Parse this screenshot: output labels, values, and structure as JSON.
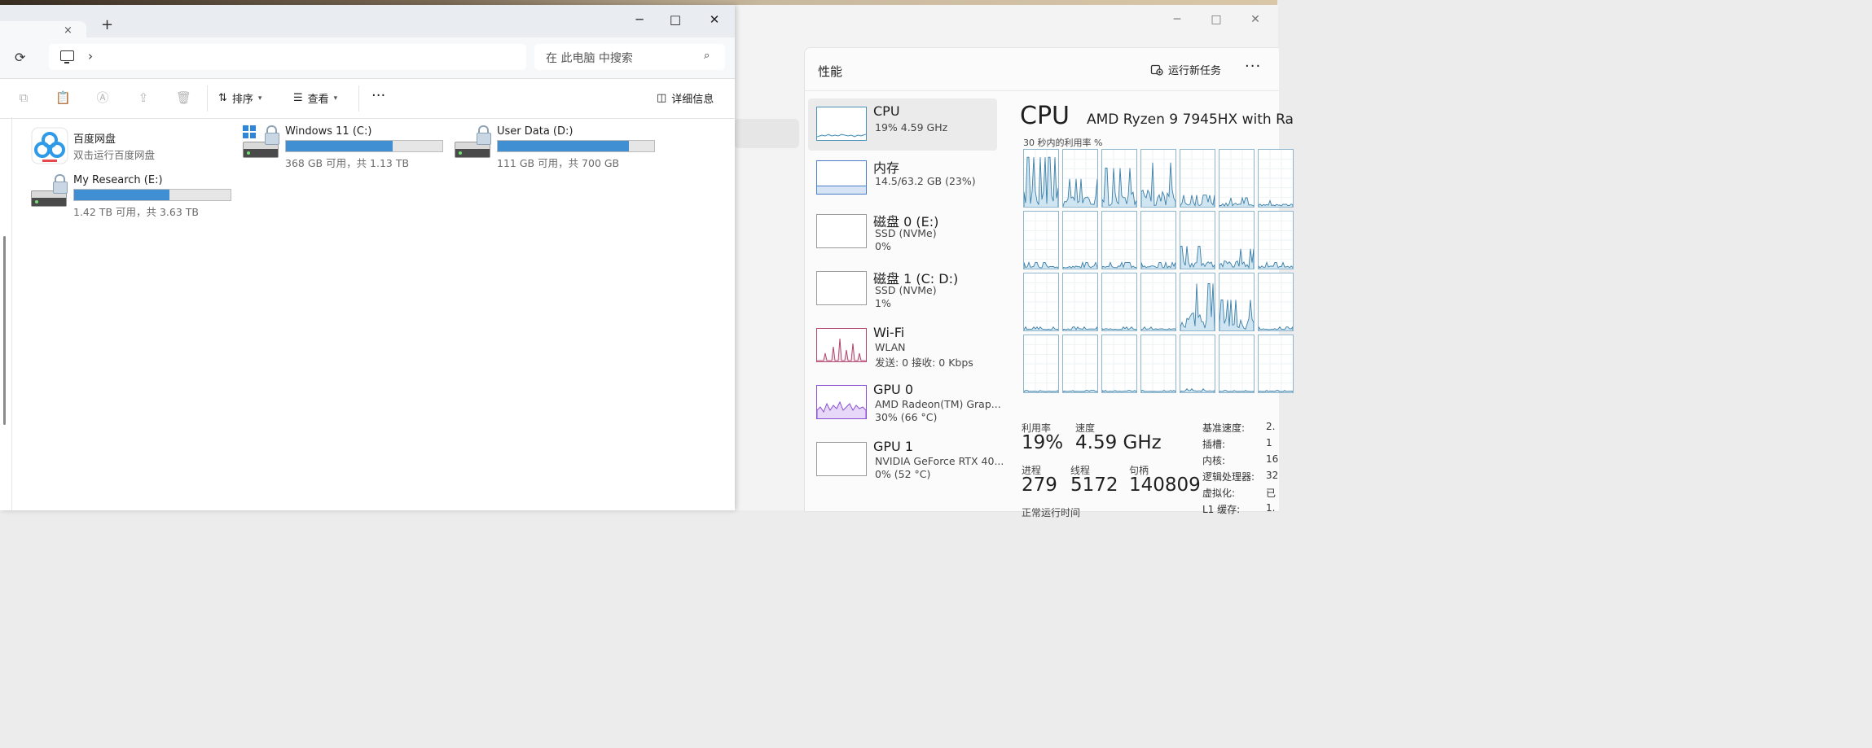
{
  "explorer": {
    "tab_close": "×",
    "new_tab": "+",
    "window_controls": {
      "minimize": "─",
      "maximize": "□",
      "close": "✕"
    },
    "refresh_icon": "⟳",
    "breadcrumb_separator": "›",
    "search_placeholder": "在 此电脑 中搜索",
    "search_icon": "⌕",
    "toolbar": {
      "sort_label": "排序",
      "view_label": "查看",
      "more_label": "···",
      "details_label": "详细信息"
    },
    "drives": [
      {
        "name": "百度网盘",
        "subtitle": "双击运行百度网盘",
        "kind": "app"
      },
      {
        "name": "Windows 11 (C:)",
        "info": "368 GB 可用，共 1.13 TB",
        "used_fraction": 0.68
      },
      {
        "name": "User Data (D:)",
        "info": "111 GB 可用，共 700 GB",
        "used_fraction": 0.84
      },
      {
        "name": "My Research (E:)",
        "info": "1.42 TB 可用，共 3.63 TB",
        "used_fraction": 0.61
      }
    ]
  },
  "taskmgr": {
    "window_controls": {
      "minimize": "─",
      "maximize": "□",
      "close": "✕"
    },
    "title": "性能",
    "run_new_task": "运行新任务",
    "more": "···",
    "items": [
      {
        "name": "CPU",
        "sub1": "19% 4.59 GHz",
        "color": "#4a90b8"
      },
      {
        "name": "内存",
        "sub1": "14.5/63.2 GB (23%)",
        "color": "#4a7fc8"
      },
      {
        "name": "磁盘 0 (E:)",
        "sub1": "SSD (NVMe)",
        "sub2": "0%",
        "color": "#5aa05a"
      },
      {
        "name": "磁盘 1 (C: D:)",
        "sub1": "SSD (NVMe)",
        "sub2": "1%",
        "color": "#5aa05a"
      },
      {
        "name": "Wi-Fi",
        "sub1": "WLAN",
        "sub2": "发送: 0 接收: 0 Kbps",
        "color": "#b0456f"
      },
      {
        "name": "GPU 0",
        "sub1": "AMD Radeon(TM) Grap...",
        "sub2": "30% (66 °C)",
        "color": "#8a4fd0"
      },
      {
        "name": "GPU 1",
        "sub1": "NVIDIA GeForce RTX 40...",
        "sub2": "0% (52 °C)",
        "color": "#8a4fd0"
      }
    ],
    "cpu_header": "CPU",
    "cpu_model": "AMD Ryzen 9 7945HX with Ra",
    "util_label": "30 秒内的利用率 %",
    "stats": {
      "util_label": "利用率",
      "util_value": "19%",
      "speed_label": "速度",
      "speed_value": "4.59 GHz",
      "proc_label": "进程",
      "proc_value": "279",
      "thread_label": "线程",
      "thread_value": "5172",
      "handle_label": "句柄",
      "handle_value": "140809",
      "uptime_label": "正常运行时间"
    },
    "details": [
      {
        "k": "基准速度:",
        "v": "2."
      },
      {
        "k": "插槽:",
        "v": "1"
      },
      {
        "k": "内核:",
        "v": "16"
      },
      {
        "k": "逻辑处理器:",
        "v": "32"
      },
      {
        "k": "虚拟化:",
        "v": "已"
      },
      {
        "k": "L1 缓存:",
        "v": "1."
      }
    ],
    "core_activity": [
      0.9,
      0.5,
      0.7,
      0.8,
      0.2,
      0.15,
      0.1,
      0.1,
      0.1,
      0.1,
      0.1,
      0.4,
      0.35,
      0.1,
      0.05,
      0.05,
      0.05,
      0.05,
      0.85,
      0.55,
      0.05,
      0.02,
      0.02,
      0.02,
      0.02,
      0.05,
      0.02,
      0.02
    ]
  }
}
